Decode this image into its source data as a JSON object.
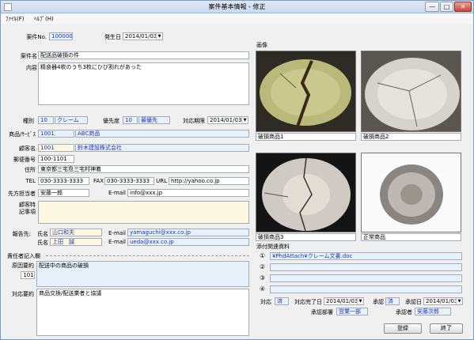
{
  "window": {
    "title": "案件基本情報 - 修正",
    "minimize": "—",
    "maximize": "□",
    "close": "✕"
  },
  "menu": {
    "file": "ﾌｧｲﾙ(F)",
    "help": "ﾍﾙﾌﾟ(H)"
  },
  "case": {
    "no_label": "案件No.",
    "no": "1000002",
    "date_label": "発生日",
    "date": "2014/01/03",
    "name_label": "案件名",
    "name": "配送品破損の件",
    "content_label": "内容",
    "content": "精食器4枚のうち3枚にひび割れがあった",
    "type_label": "種別",
    "type_code": "10",
    "type_name": "クレーム",
    "priority_label": "優先度",
    "priority_code": "10",
    "priority_name": "最優先",
    "deadline_label": "対応期限",
    "deadline": "2014/01/03"
  },
  "product": {
    "label": "商品/ｻｰﾋﾞｽ",
    "code": "1001",
    "name": "ABC商品"
  },
  "customer": {
    "name_label": "顧客名",
    "code": "1001",
    "name": "鈴木建設株式会社",
    "zip_label": "郵便番号",
    "zip": "100-1101",
    "address_label": "住所",
    "address": "東京都三宅島三宅村神着",
    "tel_label": "TEL",
    "tel": "030-3333-3333",
    "fax_label": "FAX",
    "fax": "030-3333-3333",
    "url_label": "URL",
    "url": "http://yahoo.co.jp",
    "contact_label": "先方担当者",
    "contact": "安藤一郎",
    "email_label": "E-mail",
    "email": "info@xxx.jp",
    "notes_label1": "顧客特",
    "notes_label2": "記事項",
    "notes": ""
  },
  "reporter": {
    "label": "報告先:",
    "name_label": "氏名",
    "email_label": "E-mail",
    "rows": [
      {
        "name": "山口和夫",
        "email": "yamaguchi@xxx.co.jp"
      },
      {
        "name": "上田　誠",
        "email": "ueda@xxx.co.jp"
      }
    ]
  },
  "responsible": {
    "section_label": "責任者記入欄",
    "cause_label": "原因要約",
    "cause_code": "101",
    "cause": "配送中の商品の破損",
    "action_label": "対応要約",
    "action": "商品交換/配送業者と協議"
  },
  "images": {
    "label": "画像",
    "items": [
      {
        "caption": "破損商品1"
      },
      {
        "caption": "破損商品2"
      },
      {
        "caption": "破損商品3"
      },
      {
        "caption": "正常商品"
      }
    ]
  },
  "attachments": {
    "label": "添付関連資料",
    "rows": [
      {
        "num": "①",
        "value": "¥PhdAttach¥クレーム文書.doc"
      },
      {
        "num": "②",
        "value": ""
      },
      {
        "num": "③",
        "value": ""
      },
      {
        "num": "④",
        "value": ""
      }
    ]
  },
  "status": {
    "response_label": "対応",
    "response": "済",
    "complete_label": "対応完了日",
    "complete_date": "2014/01/03",
    "approval_label": "承認",
    "approval": "済",
    "approval_date_label": "承認日",
    "approval_date": "2014/01/03",
    "dept_label": "承認部署",
    "dept": "営業一部",
    "approver_label": "承認者",
    "approver": "安藤次郎"
  },
  "buttons": {
    "register": "登録",
    "close": "終了"
  },
  "colors": {
    "titlebar": "#c9d9ee",
    "input_yellow": "#fbf7e1",
    "input_blue": "#e6f1fa",
    "link_blue": "#1f35b5"
  }
}
